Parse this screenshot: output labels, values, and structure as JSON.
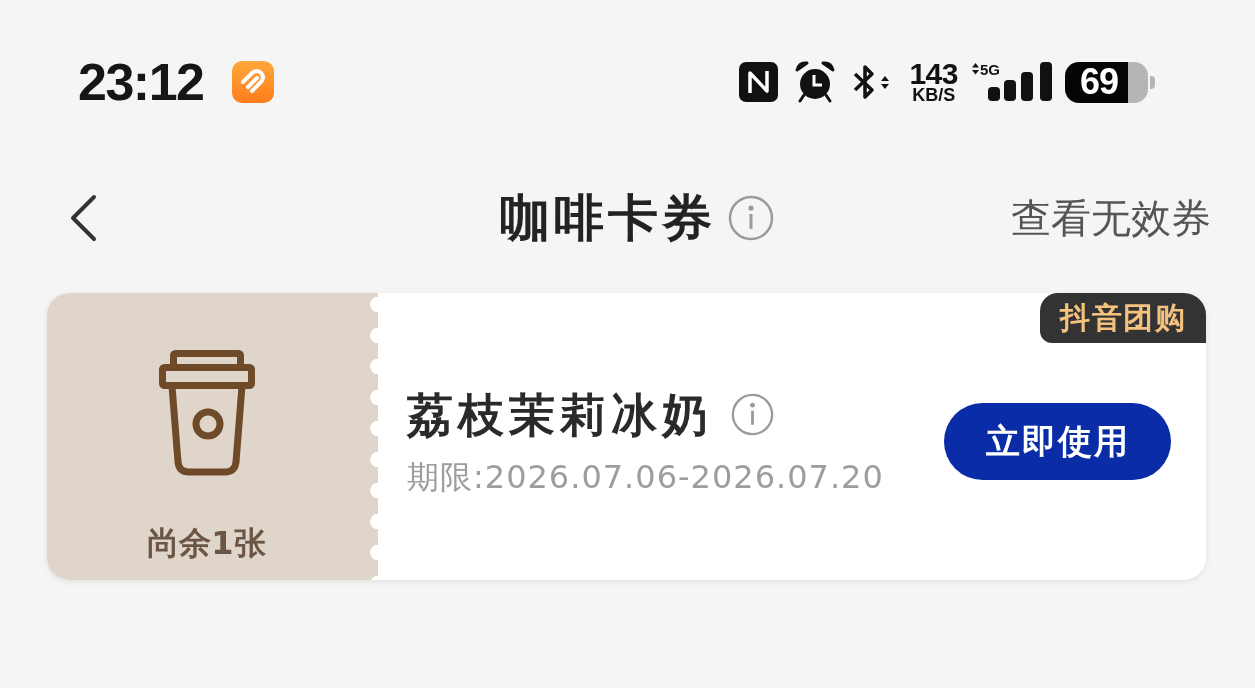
{
  "status_bar": {
    "time": "23:12",
    "network_speed": "143",
    "network_speed_unit": "KB/S",
    "network_type": "5G",
    "battery": "69"
  },
  "nav_bar": {
    "title": "咖啡卡券",
    "right_link": "查看无效券"
  },
  "coupons": [
    {
      "remaining": "尚余1张",
      "name": "荔枝茉莉冰奶",
      "validity": "期限:2026.07.06-2026.07.20",
      "tag": "抖音团购",
      "action": "立即使用"
    }
  ]
}
